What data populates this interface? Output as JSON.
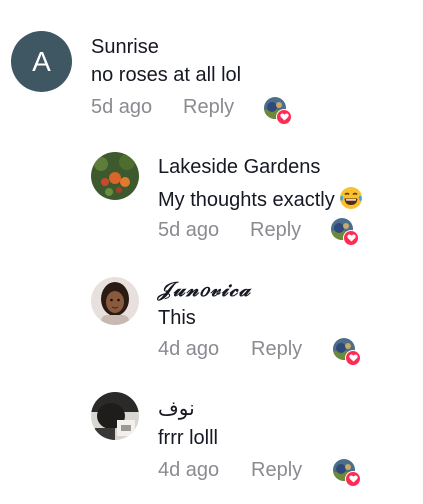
{
  "comments": [
    {
      "avatar_letter": "A",
      "username": "Sunrise",
      "text": "no roses at all lol",
      "time": "5d ago",
      "reply_label": "Reply"
    },
    {
      "username": "Lakeside Gardens",
      "text": "My thoughts exactly",
      "emoji": "laughing-with-tears-emoji",
      "time": "5d ago",
      "reply_label": "Reply"
    },
    {
      "username": "𝒥𝓊𝓃𝑜𝓋𝒾𝒸𝒶",
      "text": "This",
      "time": "4d ago",
      "reply_label": "Reply"
    },
    {
      "username": "نوف",
      "text": "frrr lolll",
      "time": "4d ago",
      "reply_label": "Reply"
    }
  ],
  "colors": {
    "text": "#161823",
    "meta": "#8a8b91",
    "heart": "#fe2c55",
    "letter_avatar_bg": "#3f5663"
  }
}
